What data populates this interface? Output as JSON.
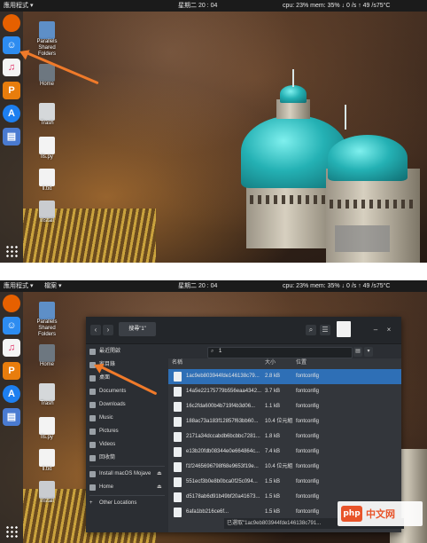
{
  "topbar": {
    "apps_menu": "應用程式 ▾",
    "files_menu": "檔案 ▾",
    "clock": "星期二 20 : 04",
    "stats": "cpu: 23% mem: 35% ↓ 0 /s ↑ 49 /s75°C"
  },
  "dock": {
    "items": [
      {
        "icon": "firefox-icon",
        "color": "#e66000"
      },
      {
        "icon": "finder-icon",
        "color": "#2d8cf0"
      },
      {
        "icon": "music-icon",
        "color": "#f4f4f4"
      },
      {
        "icon": "presentation-icon",
        "color": "#e87d0d"
      },
      {
        "icon": "app-store-icon",
        "color": "#1d7ff0"
      },
      {
        "icon": "book-icon",
        "color": "#4a7bd1"
      }
    ],
    "apps_grid_icon": "apps-grid-icon"
  },
  "desktop_icons": [
    {
      "icon": "folder-icon",
      "label": "Parallels Shared Folders"
    },
    {
      "icon": "home-folder-icon",
      "label": "Home"
    },
    {
      "icon": "trash-icon",
      "label": "Trash"
    },
    {
      "icon": "python-file-icon",
      "label": "lls.py"
    },
    {
      "icon": "text-file-icon",
      "label": "ll.txt"
    },
    {
      "icon": "install-icon",
      "label": "Install"
    }
  ],
  "dialog": {
    "path_button": "搜尋\"1\"",
    "search_query": "1",
    "sidebar": {
      "items": [
        {
          "icon": "recent-icon",
          "label": "最近開啟"
        },
        {
          "icon": "home-icon",
          "label": "家目錄"
        },
        {
          "icon": "desktop-icon",
          "label": "桌面"
        },
        {
          "icon": "documents-icon",
          "label": "Documents"
        },
        {
          "icon": "downloads-icon",
          "label": "Downloads"
        },
        {
          "icon": "music-icon",
          "label": "Music"
        },
        {
          "icon": "pictures-icon",
          "label": "Pictures"
        },
        {
          "icon": "videos-icon",
          "label": "Videos"
        },
        {
          "icon": "trash-icon",
          "label": "回收筒"
        },
        {
          "icon": "drive-icon",
          "label": "Install macOS Mojave"
        },
        {
          "icon": "drive-icon",
          "label": "Home"
        },
        {
          "icon": "plus-icon",
          "label": "Other Locations"
        }
      ]
    },
    "columns": {
      "name": "名稱",
      "size": "大小",
      "location": "位置"
    },
    "files": [
      {
        "name": "1ac9eb803944fde146138c79...",
        "size": "2.8 kB",
        "location": "fontconfig",
        "selected": true
      },
      {
        "name": "14a5e22175779b556eaa4342...",
        "size": "3.7 kB",
        "location": "fontconfig",
        "selected": false
      },
      {
        "name": "16c2fda600b4b719f4b3d06...",
        "size": "1.1 kB",
        "location": "fontconfig",
        "selected": false
      },
      {
        "name": "188ac73a183f12857f63bb60...",
        "size": "10.4 位元組",
        "location": "fontconfig",
        "selected": false
      },
      {
        "name": "2171a34dccabdb6bcbbc7281...",
        "size": "1.8 kB",
        "location": "fontconfig",
        "selected": false
      },
      {
        "name": "e13b20fdb08344e0e664864c...",
        "size": "7.4 kB",
        "location": "fontconfig",
        "selected": false
      },
      {
        "name": "f1f2465696798f68e9653f19e...",
        "size": "10.4 位元組",
        "location": "fontconfig",
        "selected": false
      },
      {
        "name": "551ecf3b0e8b0bca0f25c094...",
        "size": "1.5 kB",
        "location": "fontconfig",
        "selected": false
      },
      {
        "name": "d5178ab6d91b49bf20a41673...",
        "size": "1.5 kB",
        "location": "fontconfig",
        "selected": false
      },
      {
        "name": "6afa1bb216ce6f...",
        "size": "1.5 kB",
        "location": "fontconfig",
        "selected": false
      }
    ],
    "status": "已選取\"1ac9eb803944fde146138c791..."
  },
  "watermark": {
    "logo": "php",
    "text": "中文网"
  },
  "colors": {
    "accent_arrow": "#f07a2a",
    "selection": "#2e6fb6",
    "dome": "#24b1b4"
  }
}
